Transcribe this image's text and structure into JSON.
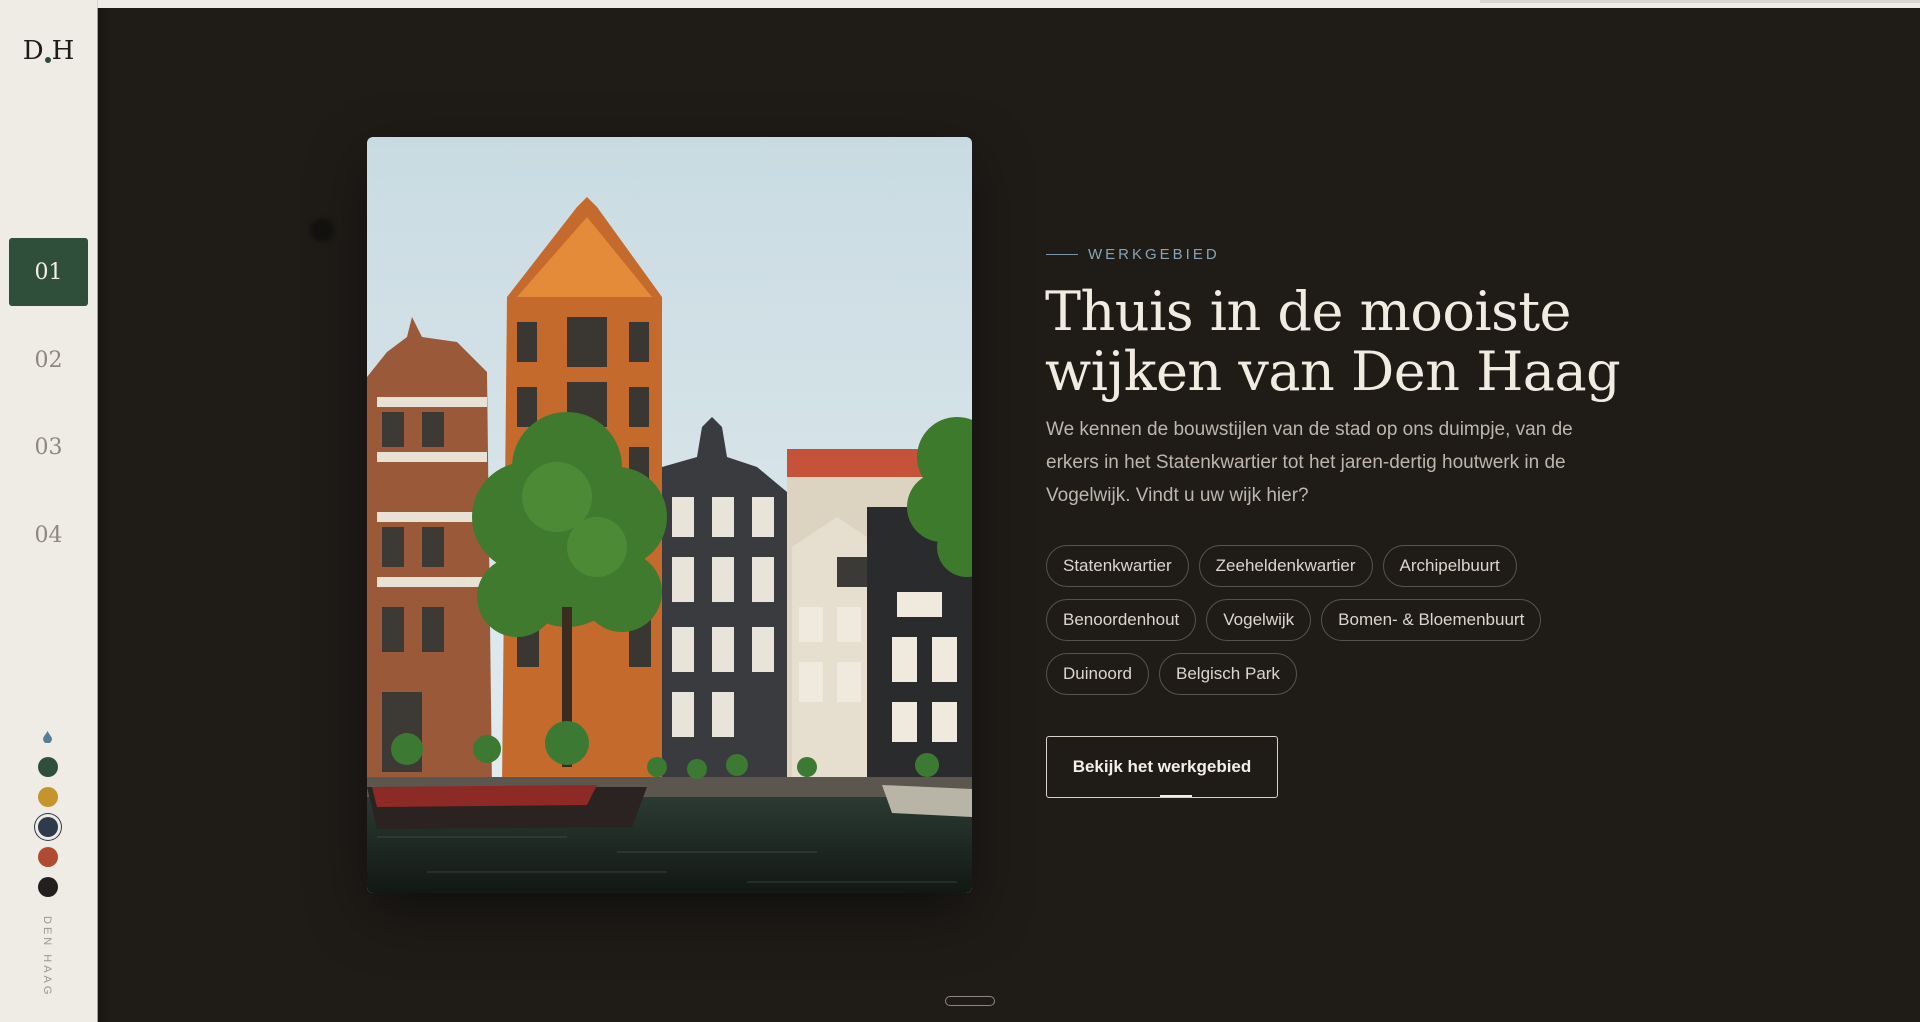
{
  "sidebar": {
    "logo": {
      "left": "D",
      "right": "H"
    },
    "nav": [
      {
        "label": "01",
        "active": true
      },
      {
        "label": "02",
        "active": false
      },
      {
        "label": "03",
        "active": false
      },
      {
        "label": "04",
        "active": false
      }
    ],
    "swatches": [
      {
        "name": "green",
        "color": "#2f4f3b"
      },
      {
        "name": "ochre",
        "color": "#c4952f"
      },
      {
        "name": "navy",
        "color": "#2d3b4b",
        "selected": true
      },
      {
        "name": "terracotta",
        "color": "#b14a32"
      },
      {
        "name": "black",
        "color": "#22201d"
      }
    ],
    "vertical_label": "DEN HAAG"
  },
  "hero": {
    "eyebrow": "WERKGEBIED",
    "headline": "Thuis in de mooiste wijken van Den Haag",
    "lead": "We kennen de bouwstijlen van de stad op ons duimpje, van de erkers in het Statenkwartier tot het jaren-dertig houtwerk in de Vogelwijk. Vindt u uw wijk hier?",
    "neighbourhoods": [
      [
        "Statenkwartier",
        "Zeeheldenkwartier",
        "Archipelbuurt"
      ],
      [
        "Benoordenhout",
        "Vogelwijk",
        "Bomen- & Bloemenbuurt"
      ],
      [
        "Duinoord",
        "Belgisch Park"
      ]
    ],
    "cta_label": "Bekijk het werkgebied"
  },
  "colors": {
    "background": "#1f1c18",
    "sidebar": "#efece6",
    "accent_green": "#2f4f3b",
    "eyebrow_blue": "#8aa3b3"
  }
}
